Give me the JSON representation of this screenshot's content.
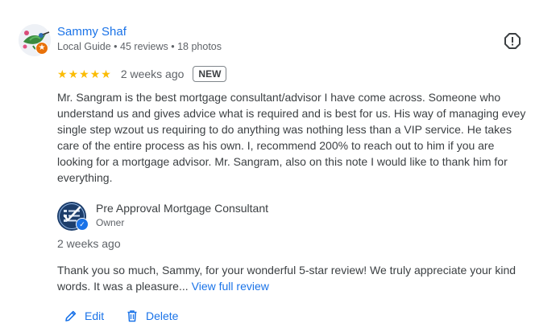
{
  "reviewer": {
    "name": "Sammy Shaf",
    "meta": "Local Guide • 45 reviews • 18 photos",
    "avatar_icon": "hummingbird-avatar",
    "badge_icon": "local-guide-star-icon"
  },
  "review": {
    "rating": 5,
    "stars": [
      "★",
      "★",
      "★",
      "★",
      "★"
    ],
    "date": "2 weeks ago",
    "new_badge": "NEW",
    "text": "Mr. Sangram is the best mortgage consultant/advisor I have come across. Someone who understand us and gives advice what is required and is best for us. His way of managing evey single step wzout us requiring to do anything was nothing less than a VIP service. He takes care of the entire process as his own. I, recommend 200% to reach out to him if you are looking for a mortgage advisor. Mr. Sangram, also on this note I would like to thank him for everything."
  },
  "owner_reply": {
    "name": "Pre Approval Mortgage Consultant",
    "role": "Owner",
    "date": "2 weeks ago",
    "text": "Thank you so much, Sammy, for your wonderful 5-star review! We truly appreciate your kind words. It was a pleasure...",
    "view_full_label": "View full review"
  },
  "actions": {
    "edit_label": "Edit",
    "delete_label": "Delete"
  },
  "colors": {
    "link": "#1a73e8",
    "star": "#fbbc04",
    "badge_orange": "#e8710a",
    "text": "#3c4043",
    "muted": "#5f6368"
  }
}
